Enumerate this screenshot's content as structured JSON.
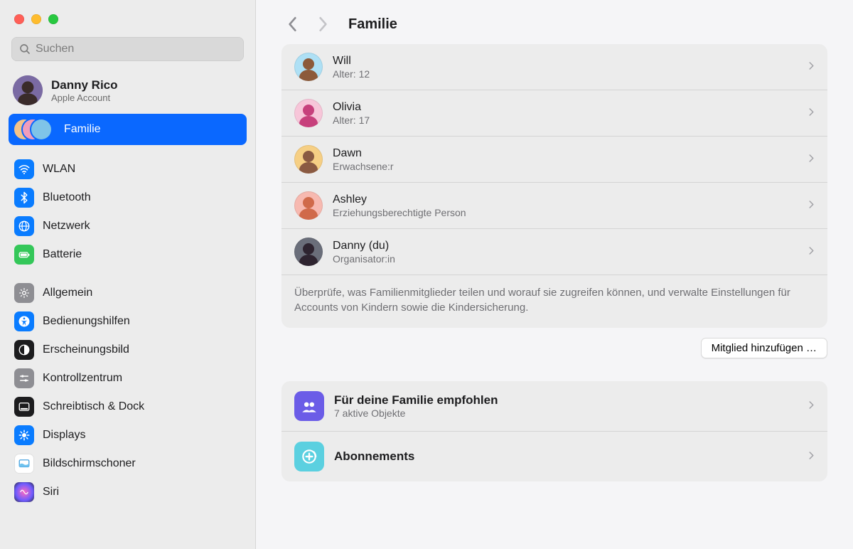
{
  "search": {
    "placeholder": "Suchen"
  },
  "account": {
    "name": "Danny Rico",
    "subtitle": "Apple Account"
  },
  "sidebar": {
    "family_label": "Familie",
    "items": [
      {
        "label": "WLAN",
        "icon": "wifi",
        "bg": "bg-blue"
      },
      {
        "label": "Bluetooth",
        "icon": "bluetooth",
        "bg": "bg-blue"
      },
      {
        "label": "Netzwerk",
        "icon": "globe",
        "bg": "bg-blue"
      },
      {
        "label": "Batterie",
        "icon": "battery",
        "bg": "bg-green"
      }
    ],
    "items2": [
      {
        "label": "Allgemein",
        "icon": "gear",
        "bg": "bg-gray"
      },
      {
        "label": "Bedienungshilfen",
        "icon": "ax",
        "bg": "bg-blue"
      },
      {
        "label": "Erscheinungsbild",
        "icon": "appear",
        "bg": "bg-black"
      },
      {
        "label": "Kontrollzentrum",
        "icon": "sliders",
        "bg": "bg-gray"
      },
      {
        "label": "Schreibtisch & Dock",
        "icon": "dock",
        "bg": "bg-black"
      },
      {
        "label": "Displays",
        "icon": "display",
        "bg": "bg-blue"
      },
      {
        "label": "Bildschirmschoner",
        "icon": "ssaver",
        "bg": "bg-white"
      },
      {
        "label": "Siri",
        "icon": "siri",
        "bg": "bg-siri"
      }
    ]
  },
  "page": {
    "title": "Familie",
    "footer_text": "Überprüfe, was Familienmitglieder teilen und worauf sie zugreifen können, und verwalte Einstellungen für Accounts von Kindern sowie die Kindersicherung.",
    "add_button": "Mitglied hinzufügen …"
  },
  "members": [
    {
      "name": "Will",
      "subtitle": "Alter: 12",
      "avatar_bg": "#aee0f5",
      "avatar_fg": "#8c5a3a"
    },
    {
      "name": "Olivia",
      "subtitle": "Alter: 17",
      "avatar_bg": "#f7c6d9",
      "avatar_fg": "#c7407c"
    },
    {
      "name": "Dawn",
      "subtitle": "Erwachsene:r",
      "avatar_bg": "#f6cf84",
      "avatar_fg": "#8a5a42"
    },
    {
      "name": "Ashley",
      "subtitle": "Erziehungsberechtigte Person",
      "avatar_bg": "#f7b9b0",
      "avatar_fg": "#d06a4a"
    },
    {
      "name": "Danny (du)",
      "subtitle": "Organisator:in",
      "avatar_bg": "#6a6e7a",
      "avatar_fg": "#2e2430"
    }
  ],
  "features": [
    {
      "title": "Für deine Familie empfohlen",
      "subtitle": "7 aktive Objekte",
      "icon": "group",
      "bg": "fi-purple"
    },
    {
      "title": "Abonnements",
      "subtitle": "",
      "icon": "plus",
      "bg": "fi-teal"
    }
  ]
}
